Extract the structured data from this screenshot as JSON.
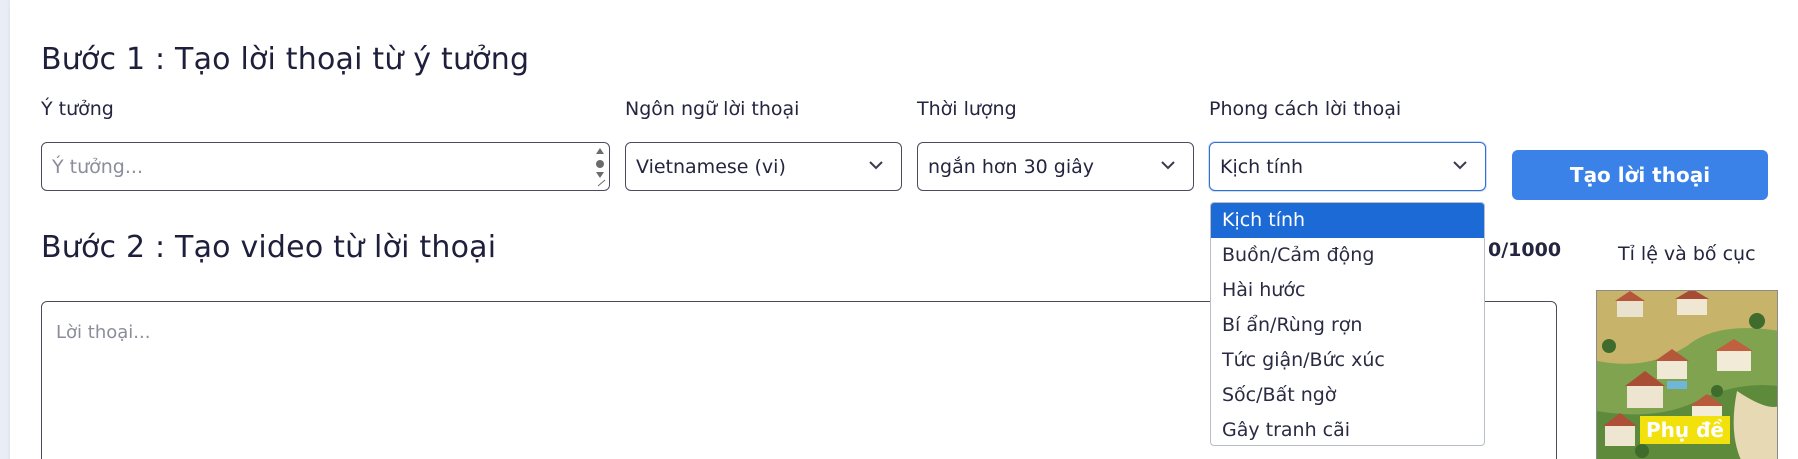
{
  "step1": {
    "title": "Bước 1 : Tạo lời thoại từ ý tưởng",
    "idea_label": "Ý tưởng",
    "idea_placeholder": "Ý tưởng...",
    "language_label": "Ngôn ngữ lời thoại",
    "language_value": "Vietnamese (vi)",
    "duration_label": "Thời lượng",
    "duration_value": "ngắn hơn 30 giây",
    "style_label": "Phong cách lời thoại",
    "style_value": "Kịch tính",
    "style_options": [
      "Kịch tính",
      "Buồn/Cảm động",
      "Hài hước",
      "Bí ẩn/Rùng rợn",
      "Tức giận/Bức xúc",
      "Sốc/Bất ngờ",
      "Gây tranh cãi"
    ],
    "generate_button": "Tạo lời thoại"
  },
  "step2": {
    "title": "Bước 2 : Tạo video từ lời thoại",
    "char_counter": "0/1000",
    "ratio_label": "Tỉ lệ và bố cục",
    "script_placeholder": "Lời thoại...",
    "thumbnail_caption": "Phụ đề"
  },
  "colors": {
    "accent": "#3b82e8",
    "selected_option": "#1c6ad6",
    "caption_bg": "#f2e10d"
  }
}
